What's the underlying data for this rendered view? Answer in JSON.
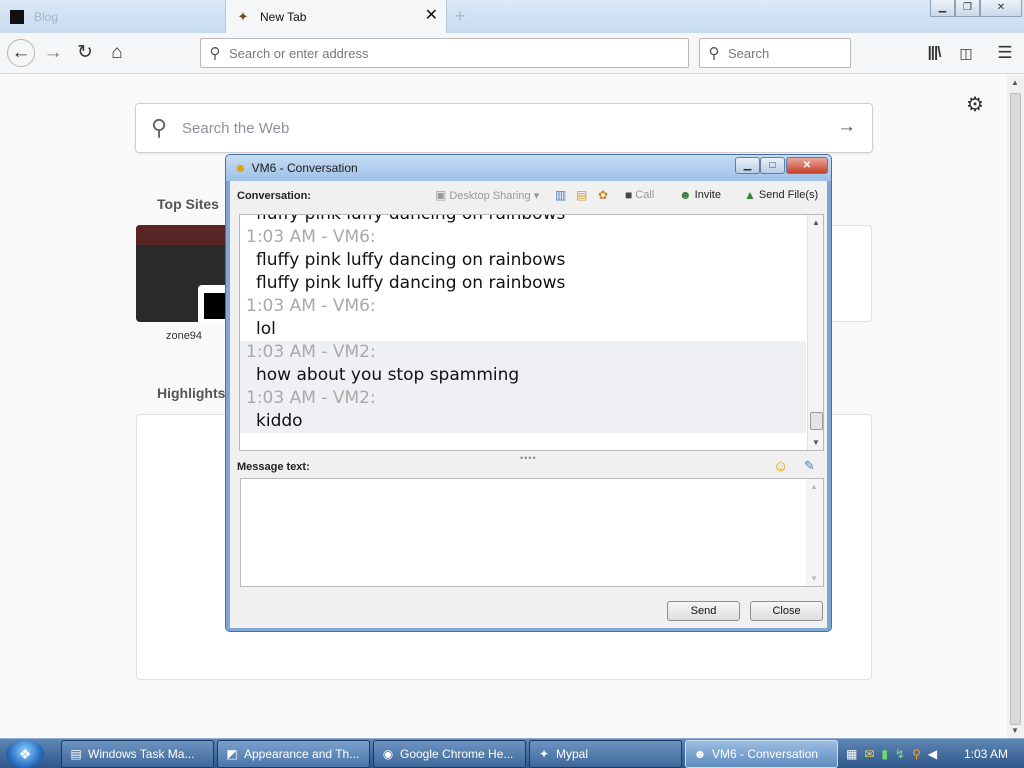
{
  "browser": {
    "tabs": [
      {
        "label": "Blog",
        "active": false
      },
      {
        "label": "New Tab",
        "active": true
      }
    ],
    "tab_close": "✕",
    "new_tab": "+",
    "window_controls": {
      "minimize": "▁",
      "maximize": "❐",
      "close": "✕"
    },
    "nav": {
      "back": "←",
      "forward": "→",
      "reload": "↻",
      "home": "⌂",
      "library": "|||\\",
      "sidebar": "◫",
      "menu": "☰"
    },
    "url_placeholder": "Search or enter address",
    "search_placeholder": "Search",
    "search_glyph": "⚲"
  },
  "newtab": {
    "web_search_placeholder": "Search the Web",
    "go_arrow": "→",
    "gear": "⚙",
    "top_sites_title": "Top Sites",
    "top_sites": [
      {
        "label": "zone94"
      }
    ],
    "highlights_title": "Highlights",
    "scroll_up": "▲",
    "scroll_down": "▼"
  },
  "conversation": {
    "title": "VM6 - Conversation",
    "title_icon": "☻",
    "controls": {
      "minimize": "▁",
      "maximize": "□",
      "close": "✕"
    },
    "toolbar": {
      "label": "Conversation:",
      "desktop_sharing": "Desktop Sharing ▾",
      "call": "Call",
      "invite": "Invite",
      "send_files": "Send File(s)"
    },
    "messages": [
      {
        "header": "",
        "lines": [
          "fluffy pink luffy dancing on rainbows"
        ]
      },
      {
        "header": "1:03 AM - VM6:",
        "lines": [
          "fluffy pink luffy dancing on rainbows",
          "fluffy pink luffy dancing on rainbows"
        ]
      },
      {
        "header": "1:03 AM - VM6:",
        "lines": [
          "lol"
        ]
      },
      {
        "header": "1:03 AM - VM2:",
        "lines": [
          "how about you stop spamming"
        ]
      },
      {
        "header": "1:03 AM - VM2:",
        "lines": [
          "kiddo"
        ]
      }
    ],
    "splitter": "••••",
    "message_label": "Message text:",
    "message_value": "",
    "emoji_icon": "☺",
    "format_icon": "✎",
    "send_label": "Send",
    "close_label": "Close"
  },
  "taskbar": {
    "start": "❖",
    "tasks": [
      {
        "label": "Windows Task Ma...",
        "icon": "▤",
        "active": false
      },
      {
        "label": "Appearance and Th...",
        "icon": "◩",
        "active": false
      },
      {
        "label": "Google Chrome He...",
        "icon": "◉",
        "active": false
      },
      {
        "label": "Mypal",
        "icon": "✦",
        "active": false
      },
      {
        "label": "VM6 - Conversation",
        "icon": "☻",
        "active": true
      }
    ],
    "clock": "1:03 AM"
  }
}
